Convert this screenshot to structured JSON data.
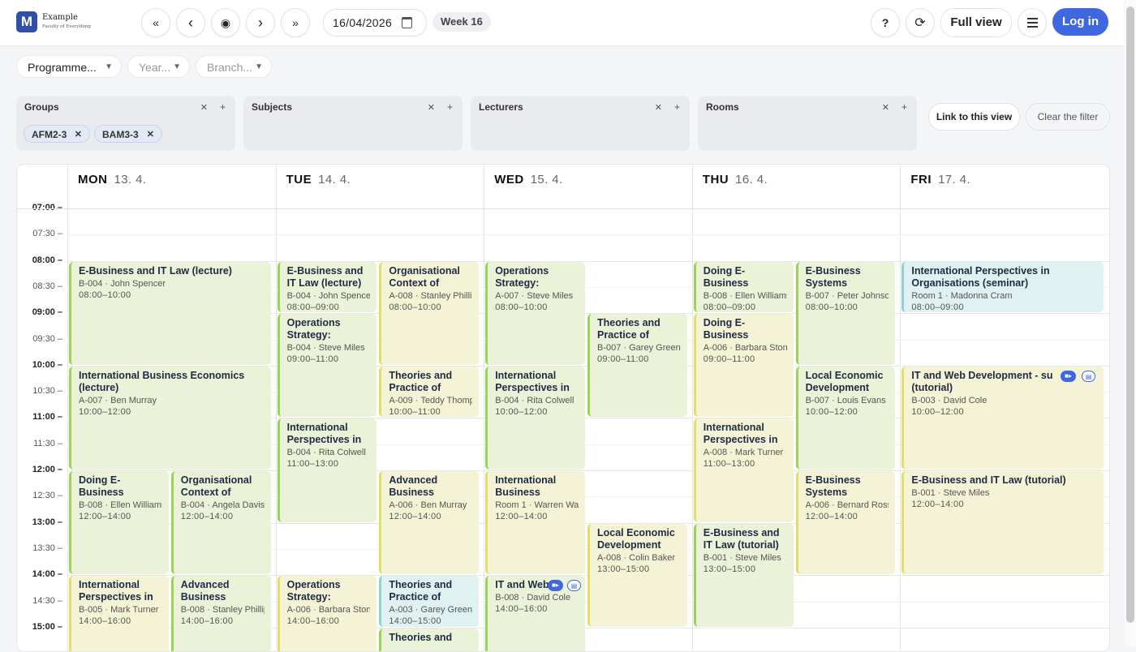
{
  "app": {
    "logo_letter": "M",
    "name": "Example",
    "subtitle": "Faculty of Everything"
  },
  "toolbar": {
    "first_icon": "«",
    "prev_icon": "‹",
    "today_icon": "◉",
    "next_icon": "›",
    "last_icon": "»",
    "date_value": "16/04/2026",
    "week_label": "Week 16",
    "help_icon": "?",
    "refresh_icon": "⟳",
    "full_view_label": "Full view",
    "login_label": "Log in"
  },
  "selects": [
    {
      "label": "Programme...",
      "muted": false
    },
    {
      "label": "Year...",
      "muted": true
    },
    {
      "label": "Branch...",
      "muted": true
    }
  ],
  "filters": [
    {
      "title": "Groups",
      "chips": [
        "AFM2-3",
        "BAM3-3"
      ]
    },
    {
      "title": "Subjects",
      "chips": []
    },
    {
      "title": "Lecturers",
      "chips": []
    },
    {
      "title": "Rooms",
      "chips": []
    }
  ],
  "filter_actions": {
    "link_label": "Link to this view",
    "clear_label": "Clear the filter"
  },
  "calendar": {
    "days": [
      {
        "name": "MON",
        "date": "13. 4."
      },
      {
        "name": "TUE",
        "date": "14. 4."
      },
      {
        "name": "WED",
        "date": "15. 4."
      },
      {
        "name": "THU",
        "date": "16. 4."
      },
      {
        "name": "FRI",
        "date": "17. 4."
      }
    ],
    "times": [
      "07:00",
      "07:30",
      "08:00",
      "08:30",
      "09:00",
      "09:30",
      "10:00",
      "10:30",
      "11:00",
      "11:30",
      "12:00",
      "12:30",
      "13:00",
      "13:30",
      "14:00",
      "14:30",
      "15:00"
    ],
    "events": [
      {
        "day": 0,
        "col": 0,
        "cols": 1,
        "start": "08:00",
        "end": "10:00",
        "title": "E-Business and IT Law (lecture)",
        "room": "B-004",
        "lecturer": "John Spencer",
        "time": "08:00–10:00",
        "color": "green"
      },
      {
        "day": 0,
        "col": 0,
        "cols": 1,
        "start": "10:00",
        "end": "12:00",
        "title": "International Business Economics (lecture)",
        "room": "A-007",
        "lecturer": "Ben Murray",
        "time": "10:00–12:00",
        "color": "green"
      },
      {
        "day": 0,
        "col": 0,
        "cols": 2,
        "start": "12:00",
        "end": "14:00",
        "title": "Doing E-Business",
        "room": "B-008",
        "lecturer": "Ellen Williams",
        "time": "12:00–14:00",
        "color": "green"
      },
      {
        "day": 0,
        "col": 1,
        "cols": 2,
        "start": "12:00",
        "end": "14:00",
        "title": "Organisational Context of",
        "room": "B-004",
        "lecturer": "Angela Davis",
        "time": "12:00–14:00",
        "color": "green"
      },
      {
        "day": 0,
        "col": 0,
        "cols": 2,
        "start": "14:00",
        "end": "16:00",
        "title": "International Perspectives in",
        "room": "B-005",
        "lecturer": "Mark Turner",
        "time": "14:00–16:00",
        "color": "yellow"
      },
      {
        "day": 0,
        "col": 1,
        "cols": 2,
        "start": "14:00",
        "end": "16:00",
        "title": "Advanced Business",
        "room": "B-008",
        "lecturer": "Stanley Phillips",
        "time": "14:00–16:00",
        "color": "green"
      },
      {
        "day": 1,
        "col": 0,
        "cols": 2,
        "start": "08:00",
        "end": "09:00",
        "title": "E-Business and IT Law (lecture)",
        "room": "B-004",
        "lecturer": "John Spencer",
        "time": "08:00–09:00",
        "color": "green"
      },
      {
        "day": 1,
        "col": 1,
        "cols": 2,
        "start": "08:00",
        "end": "10:00",
        "title": "Organisational Context of",
        "room": "A-008",
        "lecturer": "Stanley Phillips",
        "time": "08:00–10:00",
        "color": "yellow"
      },
      {
        "day": 1,
        "col": 0,
        "cols": 2,
        "start": "09:00",
        "end": "11:00",
        "title": "Operations Strategy:",
        "room": "B-004",
        "lecturer": "Steve Miles",
        "time": "09:00–11:00",
        "color": "green"
      },
      {
        "day": 1,
        "col": 1,
        "cols": 2,
        "start": "10:00",
        "end": "11:00",
        "title": "Theories and Practice of",
        "room": "A-009",
        "lecturer": "Teddy Thompson",
        "time": "10:00–11:00",
        "color": "yellow"
      },
      {
        "day": 1,
        "col": 0,
        "cols": 2,
        "start": "11:00",
        "end": "13:00",
        "title": "International Perspectives in",
        "room": "B-004",
        "lecturer": "Rita Colwell",
        "time": "11:00–13:00",
        "color": "green"
      },
      {
        "day": 1,
        "col": 1,
        "cols": 2,
        "start": "12:00",
        "end": "14:00",
        "title": "Advanced Business",
        "room": "A-006",
        "lecturer": "Ben Murray",
        "time": "12:00–14:00",
        "color": "yellow"
      },
      {
        "day": 1,
        "col": 0,
        "cols": 2,
        "start": "14:00",
        "end": "16:00",
        "title": "Operations Strategy:",
        "room": "A-006",
        "lecturer": "Barbara Stone",
        "time": "14:00–16:00",
        "color": "yellow"
      },
      {
        "day": 1,
        "col": 1,
        "cols": 2,
        "start": "14:00",
        "end": "15:00",
        "title": "Theories and Practice of",
        "room": "A-003",
        "lecturer": "Garey Green",
        "time": "14:00–15:00",
        "color": "teal"
      },
      {
        "day": 1,
        "col": 1,
        "cols": 2,
        "start": "15:00",
        "end": "16:00",
        "title": "Theories and",
        "room": "",
        "lecturer": "",
        "time": "",
        "color": "green"
      },
      {
        "day": 2,
        "col": 0,
        "cols": 2,
        "start": "08:00",
        "end": "10:00",
        "title": "Operations Strategy:",
        "room": "A-007",
        "lecturer": "Steve Miles",
        "time": "08:00–10:00",
        "color": "green"
      },
      {
        "day": 2,
        "col": 1,
        "cols": 2,
        "start": "09:00",
        "end": "11:00",
        "title": "Theories and Practice of",
        "room": "B-007",
        "lecturer": "Garey Green",
        "time": "09:00–11:00",
        "color": "green"
      },
      {
        "day": 2,
        "col": 0,
        "cols": 2,
        "start": "10:00",
        "end": "12:00",
        "title": "International Perspectives in",
        "room": "B-004",
        "lecturer": "Rita Colwell",
        "time": "10:00–12:00",
        "color": "green"
      },
      {
        "day": 2,
        "col": 0,
        "cols": 2,
        "start": "12:00",
        "end": "14:00",
        "title": "International Business",
        "room": "Room 1",
        "lecturer": "Warren Walker",
        "time": "12:00–14:00",
        "color": "yellow"
      },
      {
        "day": 2,
        "col": 1,
        "cols": 2,
        "start": "13:00",
        "end": "15:00",
        "title": "Local Economic Development",
        "room": "A-008",
        "lecturer": "Colin Baker",
        "time": "13:00–15:00",
        "color": "yellow"
      },
      {
        "day": 2,
        "col": 0,
        "cols": 2,
        "start": "14:00",
        "end": "16:00",
        "title": "IT and Web",
        "room": "B-008",
        "lecturer": "David Cole",
        "time": "14:00–16:00",
        "color": "green",
        "icons": true
      },
      {
        "day": 3,
        "col": 0,
        "cols": 2,
        "start": "08:00",
        "end": "09:00",
        "title": "Doing E-Business",
        "room": "B-008",
        "lecturer": "Ellen Williams",
        "time": "08:00–09:00",
        "color": "green"
      },
      {
        "day": 3,
        "col": 1,
        "cols": 2,
        "start": "08:00",
        "end": "10:00",
        "title": "E-Business Systems",
        "room": "B-007",
        "lecturer": "Peter Johnson",
        "time": "08:00–10:00",
        "color": "green"
      },
      {
        "day": 3,
        "col": 0,
        "cols": 2,
        "start": "09:00",
        "end": "11:00",
        "title": "Doing E-Business",
        "room": "A-006",
        "lecturer": "Barbara Stone",
        "time": "09:00–11:00",
        "color": "yellow"
      },
      {
        "day": 3,
        "col": 1,
        "cols": 2,
        "start": "10:00",
        "end": "12:00",
        "title": "Local Economic Development",
        "room": "B-007",
        "lecturer": "Louis Evans",
        "time": "10:00–12:00",
        "color": "green"
      },
      {
        "day": 3,
        "col": 0,
        "cols": 2,
        "start": "11:00",
        "end": "13:00",
        "title": "International Perspectives in",
        "room": "A-008",
        "lecturer": "Mark Turner",
        "time": "11:00–13:00",
        "color": "yellow"
      },
      {
        "day": 3,
        "col": 1,
        "cols": 2,
        "start": "12:00",
        "end": "14:00",
        "title": "E-Business Systems",
        "room": "A-006",
        "lecturer": "Bernard Ross",
        "time": "12:00–14:00",
        "color": "yellow"
      },
      {
        "day": 3,
        "col": 0,
        "cols": 2,
        "start": "13:00",
        "end": "15:00",
        "title": "E-Business and IT Law (tutorial)",
        "room": "B-001",
        "lecturer": "Steve Miles",
        "time": "13:00–15:00",
        "color": "green"
      },
      {
        "day": 4,
        "col": 0,
        "cols": 1,
        "start": "08:00",
        "end": "09:00",
        "title": "International Perspectives in Organisations (seminar)",
        "room": "Room 1",
        "lecturer": "Madonna Cram",
        "time": "08:00–09:00",
        "color": "teal"
      },
      {
        "day": 4,
        "col": 0,
        "cols": 1,
        "start": "10:00",
        "end": "12:00",
        "title": "IT and Web Development - su (tutorial)",
        "room": "B-003",
        "lecturer": "David Cole",
        "time": "10:00–12:00",
        "color": "yellow",
        "icons": true
      },
      {
        "day": 4,
        "col": 0,
        "cols": 1,
        "start": "12:00",
        "end": "14:00",
        "title": "E-Business and IT Law (tutorial)",
        "room": "B-001",
        "lecturer": "Steve Miles",
        "time": "12:00–14:00",
        "color": "yellow"
      }
    ]
  },
  "colors": {
    "accent": "#3f67e0",
    "green_bg": "#eaf2d8",
    "green_border": "#9bd35a",
    "yellow_bg": "#f5f3d6",
    "yellow_border": "#e6dc6a",
    "teal_bg": "#dff1f1",
    "teal_border": "#8fd3cf",
    "icon_blue": "#3f67e0"
  }
}
